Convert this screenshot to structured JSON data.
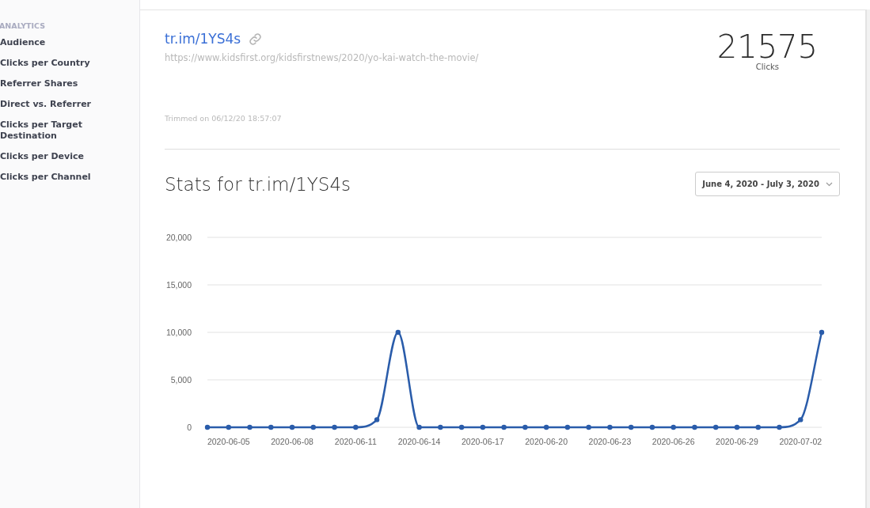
{
  "sidebar": {
    "heading": "ANALYTICS",
    "items": [
      {
        "label": "Audience"
      },
      {
        "label": "Clicks per Country"
      },
      {
        "label": "Referrer Shares"
      },
      {
        "label": "Direct vs. Referrer"
      },
      {
        "label": "Clicks per Target Destination"
      },
      {
        "label": "Clicks per Device"
      },
      {
        "label": "Clicks per Channel"
      }
    ]
  },
  "link": {
    "short_url": "tr.im/1YS4s",
    "long_url": "https://www.kidsfirst.org/kidsfirstnews/2020/yo-kai-watch-the-movie/",
    "trimmed": "Trimmed on 06/12/20 18:57:07"
  },
  "total": {
    "value": "21575",
    "label": "Clicks"
  },
  "stats": {
    "title": "Stats for tr.im/1YS4s",
    "date_range": "June 4, 2020 - July 3, 2020",
    "chart_data": {
      "type": "line",
      "grid": true,
      "xlim": [
        "2020-06-04",
        "2020-07-03"
      ],
      "x": [
        "2020-06-04",
        "2020-06-05",
        "2020-06-06",
        "2020-06-07",
        "2020-06-08",
        "2020-06-09",
        "2020-06-10",
        "2020-06-11",
        "2020-06-12",
        "2020-06-13",
        "2020-06-14",
        "2020-06-15",
        "2020-06-16",
        "2020-06-17",
        "2020-06-18",
        "2020-06-19",
        "2020-06-20",
        "2020-06-21",
        "2020-06-22",
        "2020-06-23",
        "2020-06-24",
        "2020-06-25",
        "2020-06-26",
        "2020-06-27",
        "2020-06-28",
        "2020-06-29",
        "2020-06-30",
        "2020-07-01",
        "2020-07-02",
        "2020-07-03"
      ],
      "series": [
        {
          "color": "#2a5caa",
          "marker": "circle",
          "values": [
            0,
            0,
            0,
            0,
            0,
            0,
            0,
            0,
            800,
            10000,
            0,
            0,
            0,
            0,
            0,
            0,
            0,
            0,
            0,
            0,
            0,
            0,
            0,
            0,
            0,
            0,
            0,
            0,
            800,
            10000
          ]
        }
      ],
      "xticks": [
        {
          "value": "2020-06-05",
          "label": "2020-06-05"
        },
        {
          "value": "2020-06-08",
          "label": "2020-06-08"
        },
        {
          "value": "2020-06-11",
          "label": "2020-06-11"
        },
        {
          "value": "2020-06-14",
          "label": "2020-06-14"
        },
        {
          "value": "2020-06-17",
          "label": "2020-06-17"
        },
        {
          "value": "2020-06-20",
          "label": "2020-06-20"
        },
        {
          "value": "2020-06-23",
          "label": "2020-06-23"
        },
        {
          "value": "2020-06-26",
          "label": "2020-06-26"
        },
        {
          "value": "2020-06-29",
          "label": "2020-06-29"
        },
        {
          "value": "2020-07-02",
          "label": "2020-07-02"
        }
      ],
      "ylim": [
        0,
        20000
      ],
      "yticks": [
        {
          "value": 0,
          "label": "0"
        },
        {
          "value": 5000,
          "label": "5,000"
        },
        {
          "value": 10000,
          "label": "10,000"
        },
        {
          "value": 15000,
          "label": "15,000"
        },
        {
          "value": 20000,
          "label": "20,000"
        }
      ]
    }
  }
}
